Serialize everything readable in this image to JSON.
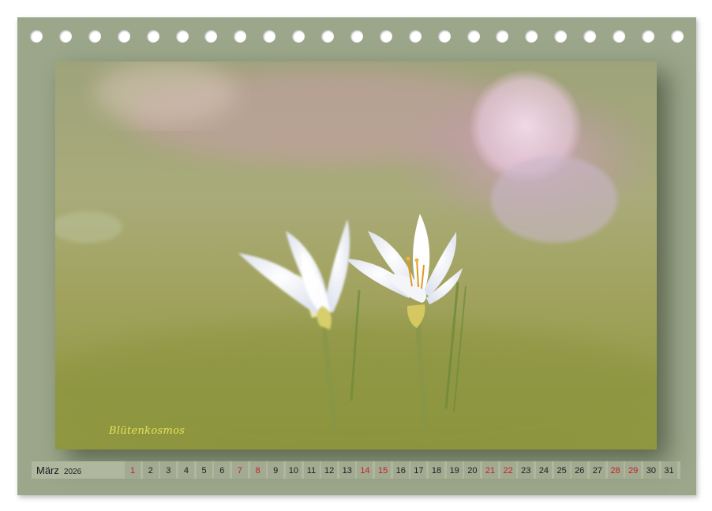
{
  "calendar": {
    "month": "März",
    "year": "2026",
    "caption": "Blütenkosmos",
    "days": [
      {
        "n": "1",
        "we": true
      },
      {
        "n": "2",
        "we": false
      },
      {
        "n": "3",
        "we": false
      },
      {
        "n": "4",
        "we": false
      },
      {
        "n": "5",
        "we": false
      },
      {
        "n": "6",
        "we": false
      },
      {
        "n": "7",
        "we": true
      },
      {
        "n": "8",
        "we": true
      },
      {
        "n": "9",
        "we": false
      },
      {
        "n": "10",
        "we": false
      },
      {
        "n": "11",
        "we": false
      },
      {
        "n": "12",
        "we": false
      },
      {
        "n": "13",
        "we": false
      },
      {
        "n": "14",
        "we": true
      },
      {
        "n": "15",
        "we": true
      },
      {
        "n": "16",
        "we": false
      },
      {
        "n": "17",
        "we": false
      },
      {
        "n": "18",
        "we": false
      },
      {
        "n": "19",
        "we": false
      },
      {
        "n": "20",
        "we": false
      },
      {
        "n": "21",
        "we": true
      },
      {
        "n": "22",
        "we": true
      },
      {
        "n": "23",
        "we": false
      },
      {
        "n": "24",
        "we": false
      },
      {
        "n": "25",
        "we": false
      },
      {
        "n": "26",
        "we": false
      },
      {
        "n": "27",
        "we": false
      },
      {
        "n": "28",
        "we": true
      },
      {
        "n": "29",
        "we": true
      },
      {
        "n": "30",
        "we": false
      },
      {
        "n": "31",
        "we": false
      }
    ],
    "colors": {
      "frame": "#9ba68a",
      "weekend": "#c42222",
      "caption": "#e8e25a"
    }
  }
}
